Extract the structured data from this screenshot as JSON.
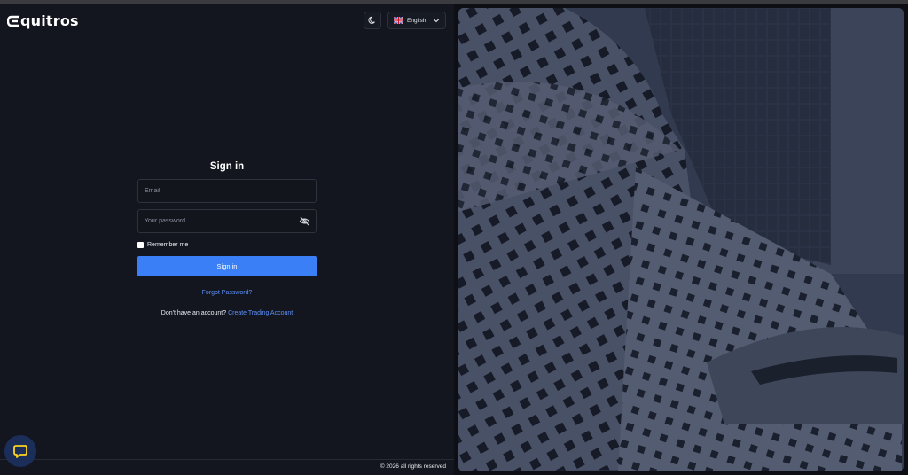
{
  "header": {
    "logo_text": "quitros",
    "language": {
      "selected": "English",
      "flag": "uk-flag-icon"
    },
    "theme_toggle_icon": "moon-icon"
  },
  "form": {
    "title": "Sign in",
    "email_placeholder": "Email",
    "password_placeholder": "Your password",
    "remember_label": "Remember me",
    "submit_label": "Sign in",
    "forgot_link": "Forgot Password?",
    "no_account_text": "Don't have an account?",
    "create_account_link": "Create Trading Account"
  },
  "footer": {
    "copyright": "© 2026 all rights reserved"
  },
  "chat_widget_icon": "chat-icon",
  "colors": {
    "accent": "#3a7ff6",
    "link": "#5b8ff8",
    "background": "#13161e",
    "overlay": "#2b3344"
  }
}
